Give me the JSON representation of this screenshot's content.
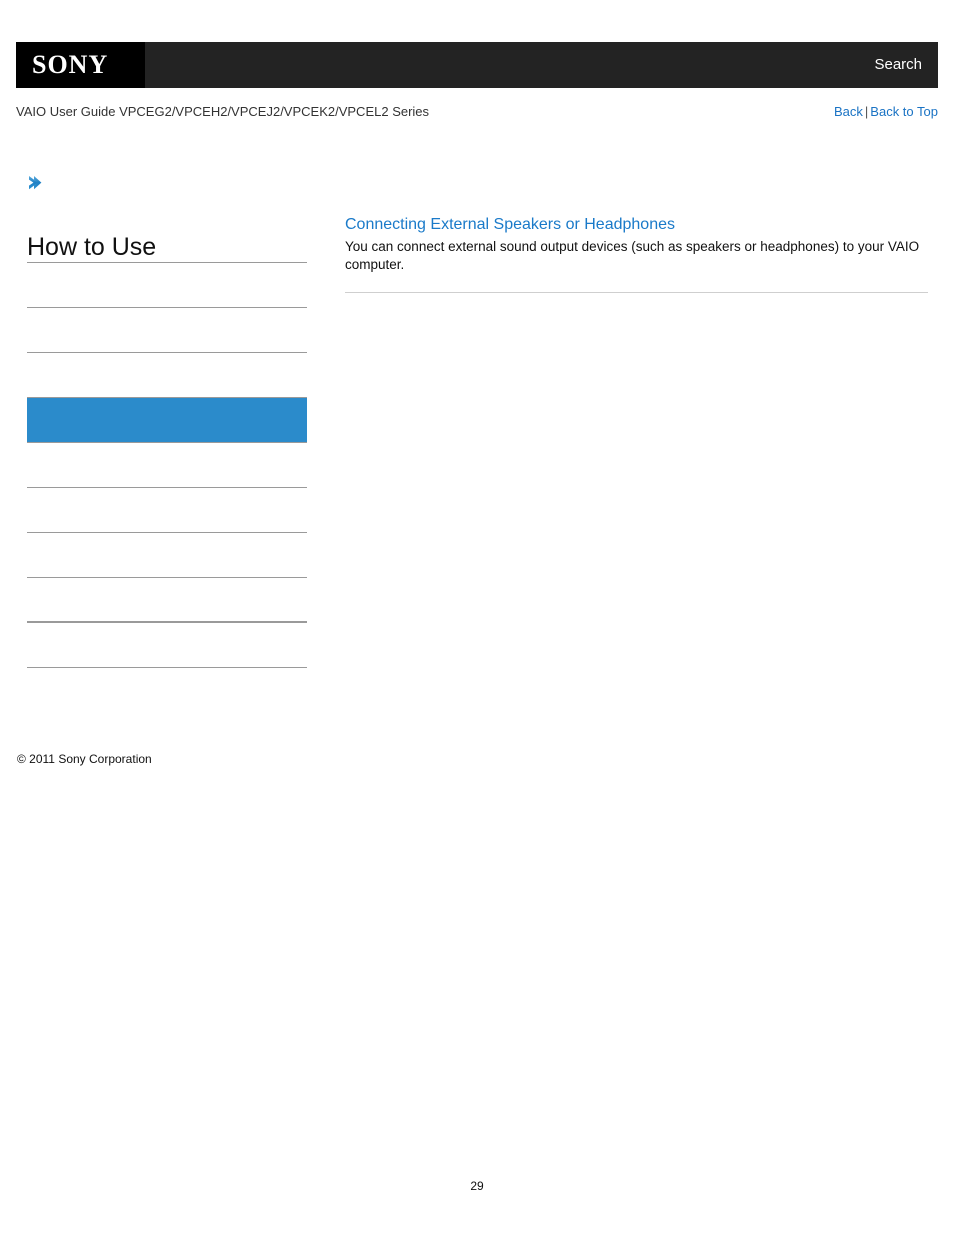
{
  "header": {
    "logo_text": "SONY",
    "logo_icon": "sony-wordmark",
    "search_label": "Search",
    "bar_color": "#232323",
    "logo_box_color": "#000000"
  },
  "subheader": {
    "guide_title": "VAIO User Guide VPCEG2/VPCEH2/VPCEJ2/VPCEK2/VPCEL2 Series",
    "back_label": "Back",
    "separator": "|",
    "back_to_top_label": "Back to Top",
    "link_color": "#1a73c4"
  },
  "sidebar": {
    "breadcrumb_icon": "chevron-right-icon",
    "heading": "How to Use",
    "selected_color": "#2b8bcb",
    "rule_color": "#9a9a9a",
    "items": [
      {
        "label": "",
        "selected": false,
        "thick": false
      },
      {
        "label": "",
        "selected": false,
        "thick": false
      },
      {
        "label": "",
        "selected": false,
        "thick": false
      },
      {
        "label": "",
        "selected": true,
        "thick": false
      },
      {
        "label": "",
        "selected": false,
        "thick": false
      },
      {
        "label": "",
        "selected": false,
        "thick": false
      },
      {
        "label": "",
        "selected": false,
        "thick": false
      },
      {
        "label": "",
        "selected": false,
        "thick": true
      },
      {
        "label": "",
        "selected": false,
        "thick": false
      }
    ]
  },
  "content": {
    "title": "Connecting External Speakers or Headphones",
    "body": "You can connect external sound output devices (such as speakers or headphones) to your VAIO computer.",
    "title_color": "#1a7ac9",
    "rule_color": "#cfcfcf"
  },
  "footer": {
    "copyright": "© 2011 Sony Corporation",
    "page_number": "29"
  }
}
